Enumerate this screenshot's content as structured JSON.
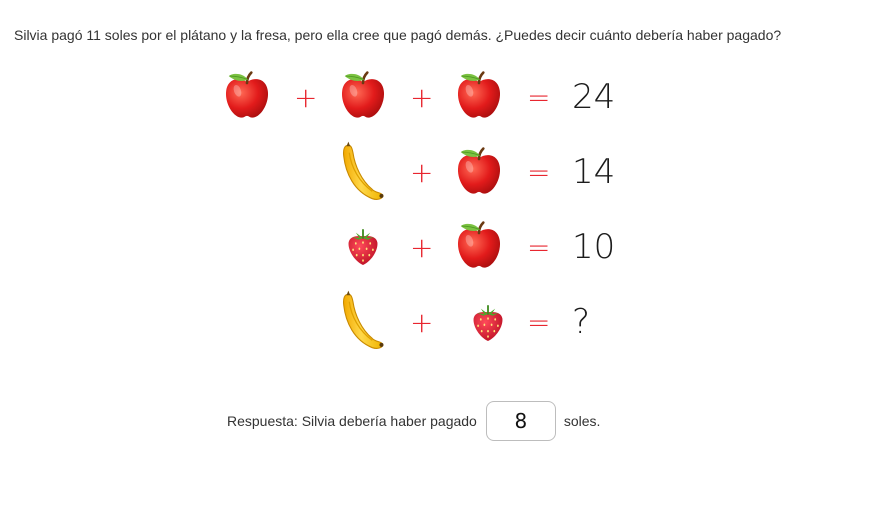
{
  "question": "Silvia pagó 11 soles por el plátano y la fresa, pero ella cree que pagó demás. ¿Puedes decir cuánto debería haber pagado?",
  "puzzle": {
    "rows": [
      {
        "fruits": [
          "apple",
          "apple",
          "apple"
        ],
        "operators": [
          "+",
          "+"
        ],
        "equals": "=",
        "result": "24"
      },
      {
        "fruits": [
          "banana",
          "apple"
        ],
        "operators": [
          "+"
        ],
        "equals": "=",
        "result": "14"
      },
      {
        "fruits": [
          "strawberry",
          "apple"
        ],
        "operators": [
          "+"
        ],
        "equals": "=",
        "result": "10"
      },
      {
        "fruits": [
          "banana",
          "strawberry"
        ],
        "operators": [
          "+"
        ],
        "equals": "=",
        "result": "?"
      }
    ]
  },
  "answer": {
    "prefix": "Respuesta: Silvia debería haber pagado",
    "value": "8",
    "suffix": "soles."
  },
  "colors": {
    "operator": "#e8262f",
    "apple": "#e21b1b",
    "banana": "#f6c21c",
    "strawberry": "#d9152b",
    "leaf": "#7cc242"
  }
}
